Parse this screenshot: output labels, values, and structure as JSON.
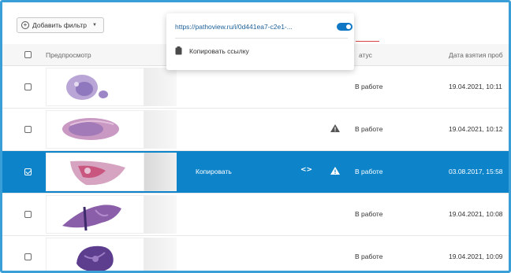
{
  "toolbar": {
    "filter_button_label": "Добавить фильтр",
    "filter_plus_glyph": "+",
    "filter_caret_glyph": "▼"
  },
  "table": {
    "headers": {
      "preview": "Предпросмотр",
      "status": "атус",
      "date": "Дата взятия проб"
    },
    "rows": [
      {
        "status": "В работе",
        "date": "19.04.2021, 10:11",
        "warning": false,
        "selected": false,
        "slide": "roundish-tissue"
      },
      {
        "status": "В работе",
        "date": "19.04.2021, 10:12",
        "warning": true,
        "selected": false,
        "slide": "oval-pink-tissue"
      },
      {
        "status": "В работе",
        "date": "03.08.2017, 15:58",
        "warning": true,
        "selected": true,
        "slide": "half-moon-tissue",
        "copy_label": "Копировать",
        "code_glyph": "<>"
      },
      {
        "status": "В работе",
        "date": "19.04.2021, 10:08",
        "warning": false,
        "selected": false,
        "slide": "purple-strip-tissue"
      },
      {
        "status": "В работе",
        "date": "19.04.2021, 10:09",
        "warning": false,
        "selected": false,
        "slide": "purple-cluster-tissue"
      }
    ]
  },
  "popup": {
    "url": "https://pathoview.ru/i/0d441ea7-c2e1-...",
    "copy_link_label": "Копировать ссылку",
    "toggle_on": true
  },
  "colors": {
    "accent": "#0d84c9",
    "frame": "#3a9fd6",
    "link": "#1a5f98",
    "toggle": "#1077c4",
    "tissue_purple": "#7a4c9e",
    "tissue_pink": "#c98fb8"
  }
}
